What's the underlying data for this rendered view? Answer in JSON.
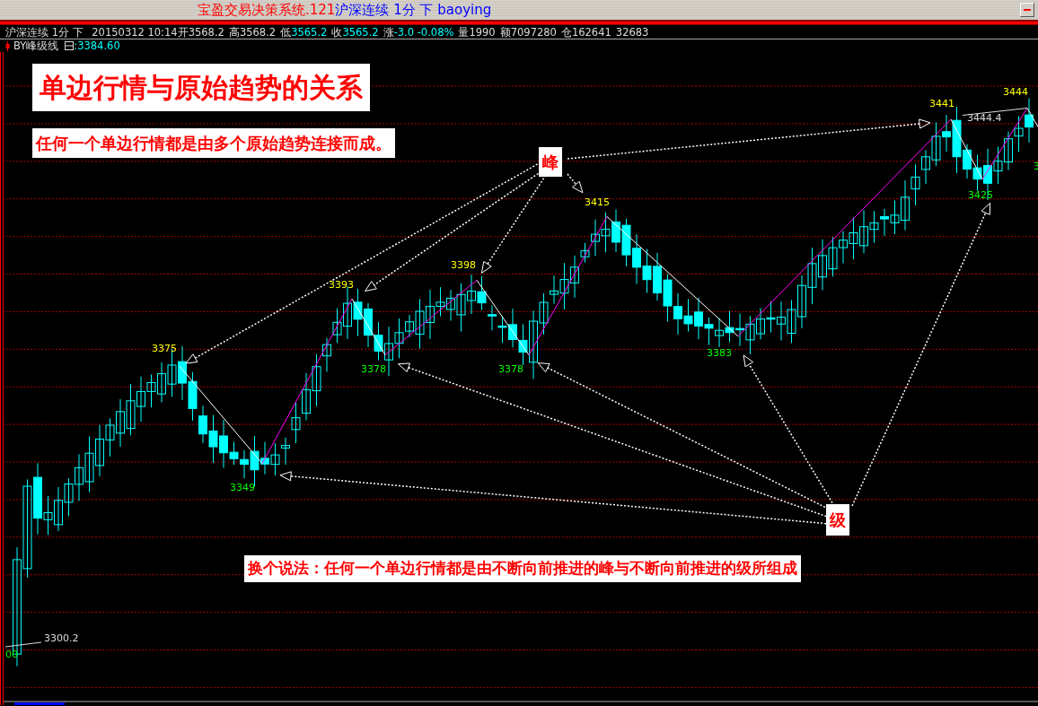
{
  "title_bar": {
    "app_name": "宝盈交易决策系统.121",
    "caption": "沪深连续 1分 下 baoying"
  },
  "info_line": {
    "symbol": "沪深连续 1分 下",
    "segments": [
      {
        "text": "20150312 10:14开3568.2",
        "kind": "label"
      },
      {
        "text": "高3568.2",
        "kind": "label"
      },
      {
        "text": "低",
        "kind": "label"
      },
      {
        "text": "3565.2",
        "kind": "value"
      },
      {
        "text": "收",
        "kind": "label"
      },
      {
        "text": "3565.2",
        "kind": "value"
      },
      {
        "text": "涨",
        "kind": "label"
      },
      {
        "text": "-3.0 -0.08%",
        "kind": "value"
      },
      {
        "text": "量1990",
        "kind": "label"
      },
      {
        "text": "额7097280",
        "kind": "label"
      },
      {
        "text": "仓162641",
        "kind": "label"
      },
      {
        "text": "32683",
        "kind": "label"
      }
    ]
  },
  "indicator": {
    "name": "BY峰级线",
    "value": ":3384.60"
  },
  "annotations": {
    "title": "单边行情与原始趋势的关系",
    "note": "任何一个单边行情都是由多个原始趋势连接而成。",
    "peak_tag": "峰",
    "level_tag": "级",
    "summary": "换个说法：任何一个单边行情都是由不断向前推进的峰与不断向前推进的级所组成"
  },
  "price_labels": [
    {
      "text": "3375",
      "kind": "peak"
    },
    {
      "text": "3393",
      "kind": "peak"
    },
    {
      "text": "3398",
      "kind": "peak"
    },
    {
      "text": "3415",
      "kind": "peak"
    },
    {
      "text": "3441",
      "kind": "peak"
    },
    {
      "text": "3444",
      "kind": "peak"
    },
    {
      "text": "3349",
      "kind": "trough"
    },
    {
      "text": "3378",
      "kind": "trough"
    },
    {
      "text": "3378",
      "kind": "trough"
    },
    {
      "text": "3383",
      "kind": "trough"
    },
    {
      "text": "3425",
      "kind": "trough"
    },
    {
      "text": "3",
      "kind": "trough"
    },
    {
      "text": "00",
      "kind": "trough"
    },
    {
      "text": "3444.4",
      "kind": "extreme"
    },
    {
      "text": "3300.2",
      "kind": "extreme"
    }
  ]
}
